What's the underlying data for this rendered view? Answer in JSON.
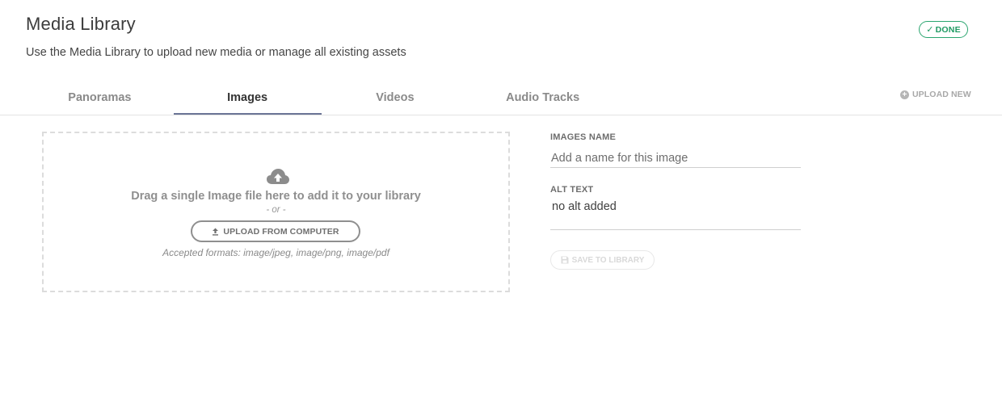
{
  "header": {
    "title": "Media Library",
    "subtitle": "Use the Media Library to upload new media or manage all existing assets",
    "done_label": "DONE",
    "done_icon": "checkmark-icon",
    "accent_color": "#2aa56f"
  },
  "tabs": [
    {
      "label": "Panoramas",
      "active": false
    },
    {
      "label": "Images",
      "active": true
    },
    {
      "label": "Videos",
      "active": false
    },
    {
      "label": "Audio Tracks",
      "active": false
    }
  ],
  "tab_indicator_color": "#6b7596",
  "upload_new": {
    "label": "UPLOAD NEW",
    "icon": "plus-circle-icon"
  },
  "dropzone": {
    "icon": "cloud-upload-icon",
    "text": "Drag a single Image file here to add it to your library",
    "or_text": "- or -",
    "button_label": "UPLOAD FROM COMPUTER",
    "button_icon": "upload-arrow-icon",
    "formats": "Accepted formats: image/jpeg, image/png, image/pdf"
  },
  "form": {
    "name_label": "IMAGES NAME",
    "name_placeholder": "Add a name for this image",
    "name_value": "",
    "alt_label": "ALT TEXT",
    "alt_value": "no alt added",
    "save_label": "SAVE TO LIBRARY",
    "save_icon": "floppy-disk-icon",
    "save_disabled": true
  }
}
